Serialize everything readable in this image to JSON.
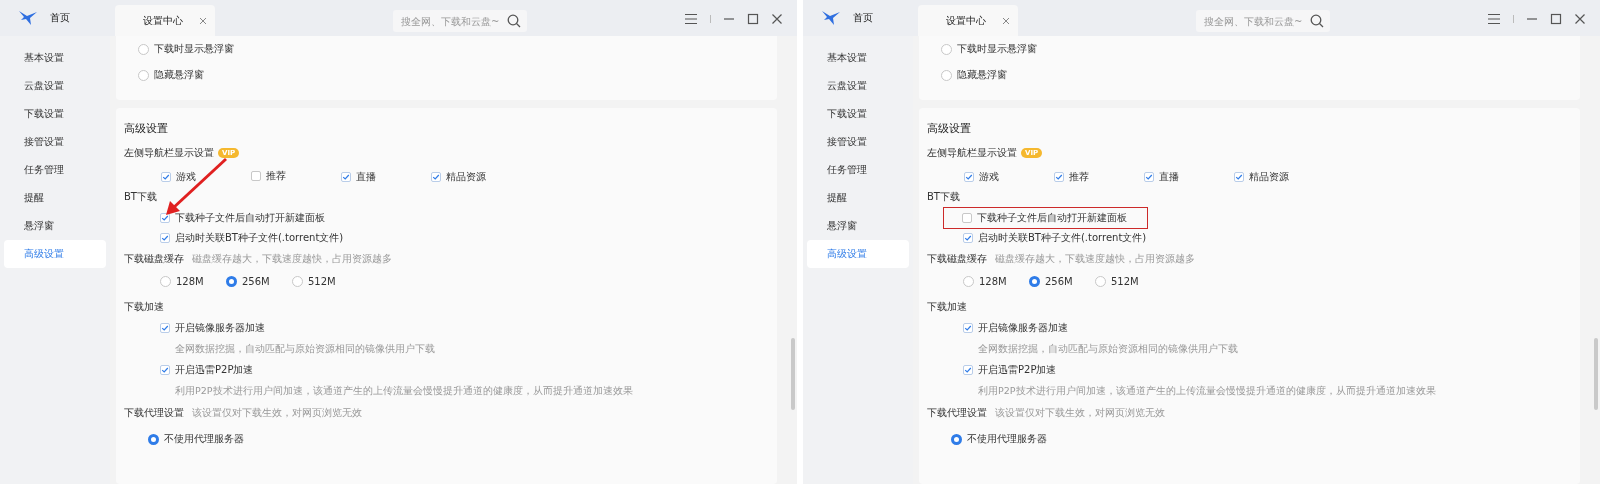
{
  "windows": [
    {
      "home_label": "首页",
      "tab": {
        "title": "设置中心"
      },
      "search": {
        "placeholder": "搜全网、下载和云盘~"
      },
      "sidebar": [
        {
          "label": "基本设置",
          "selected": false
        },
        {
          "label": "云盘设置",
          "selected": false
        },
        {
          "label": "下载设置",
          "selected": false
        },
        {
          "label": "接管设置",
          "selected": false
        },
        {
          "label": "任务管理",
          "selected": false
        },
        {
          "label": "提醒",
          "selected": false
        },
        {
          "label": "悬浮窗",
          "selected": false
        },
        {
          "label": "高级设置",
          "selected": true
        }
      ],
      "floating": [
        {
          "label": "下载时显示悬浮窗",
          "selected": false
        },
        {
          "label": "隐藏悬浮窗",
          "selected": false
        }
      ],
      "advanced": {
        "title": "高级设置",
        "nav": {
          "label": "左侧导航栏显示设置",
          "badge": "VIP",
          "options": [
            {
              "label": "游戏",
              "checked": true
            },
            {
              "label": "推荐",
              "checked": false
            },
            {
              "label": "直播",
              "checked": true
            },
            {
              "label": "精品资源",
              "checked": true
            }
          ]
        },
        "bt": {
          "label": "BT下载",
          "options": [
            {
              "label": "下载种子文件后自动打开新建面板",
              "checked": true,
              "kind": "arrow"
            },
            {
              "label": "启动时关联BT种子文件(.torrent文件)",
              "checked": true
            }
          ]
        },
        "cache": {
          "label": "下载磁盘缓存",
          "hint": "磁盘缓存越大，下载速度越快，占用资源越多",
          "options": [
            {
              "label": "128M",
              "selected": false
            },
            {
              "label": "256M",
              "selected": true
            },
            {
              "label": "512M",
              "selected": false
            }
          ]
        },
        "accel": {
          "label": "下载加速",
          "options": [
            {
              "label": "开启镜像服务器加速",
              "checked": true,
              "description": "全网数据挖掘，自动匹配与原始资源相同的镜像供用户下载"
            },
            {
              "label": "开启迅雷P2P加速",
              "checked": true,
              "description": "利用P2P技术进行用户间加速，该通道产生的上传流量会慢慢提升通道的健康度，从而提升通道加速效果"
            }
          ]
        },
        "proxy": {
          "label": "下载代理设置",
          "hint": "该设置仅对下载生效，对网页浏览无效",
          "options": [
            {
              "label": "不使用代理服务器",
              "selected": true
            }
          ]
        }
      }
    },
    {
      "home_label": "首页",
      "tab": {
        "title": "设置中心"
      },
      "search": {
        "placeholder": "搜全网、下载和云盘~"
      },
      "sidebar": [
        {
          "label": "基本设置",
          "selected": false
        },
        {
          "label": "云盘设置",
          "selected": false
        },
        {
          "label": "下载设置",
          "selected": false
        },
        {
          "label": "接管设置",
          "selected": false
        },
        {
          "label": "任务管理",
          "selected": false
        },
        {
          "label": "提醒",
          "selected": false
        },
        {
          "label": "悬浮窗",
          "selected": false
        },
        {
          "label": "高级设置",
          "selected": true
        }
      ],
      "floating": [
        {
          "label": "下载时显示悬浮窗",
          "selected": false
        },
        {
          "label": "隐藏悬浮窗",
          "selected": false
        }
      ],
      "advanced": {
        "title": "高级设置",
        "nav": {
          "label": "左侧导航栏显示设置",
          "badge": "VIP",
          "options": [
            {
              "label": "游戏",
              "checked": true
            },
            {
              "label": "推荐",
              "checked": true
            },
            {
              "label": "直播",
              "checked": true
            },
            {
              "label": "精品资源",
              "checked": true
            }
          ]
        },
        "bt": {
          "label": "BT下载",
          "options": [
            {
              "label": "下载种子文件后自动打开新建面板",
              "checked": false,
              "kind": "box"
            },
            {
              "label": "启动时关联BT种子文件(.torrent文件)",
              "checked": true
            }
          ]
        },
        "cache": {
          "label": "下载磁盘缓存",
          "hint": "磁盘缓存越大，下载速度越快，占用资源越多",
          "options": [
            {
              "label": "128M",
              "selected": false
            },
            {
              "label": "256M",
              "selected": true
            },
            {
              "label": "512M",
              "selected": false
            }
          ]
        },
        "accel": {
          "label": "下载加速",
          "options": [
            {
              "label": "开启镜像服务器加速",
              "checked": true,
              "description": "全网数据挖掘，自动匹配与原始资源相同的镜像供用户下载"
            },
            {
              "label": "开启迅雷P2P加速",
              "checked": true,
              "description": "利用P2P技术进行用户间加速，该通道产生的上传流量会慢慢提升通道的健康度，从而提升通道加速效果"
            }
          ]
        },
        "proxy": {
          "label": "下载代理设置",
          "hint": "该设置仅对下载生效，对网页浏览无效",
          "options": [
            {
              "label": "不使用代理服务器",
              "selected": true
            }
          ]
        }
      }
    }
  ]
}
